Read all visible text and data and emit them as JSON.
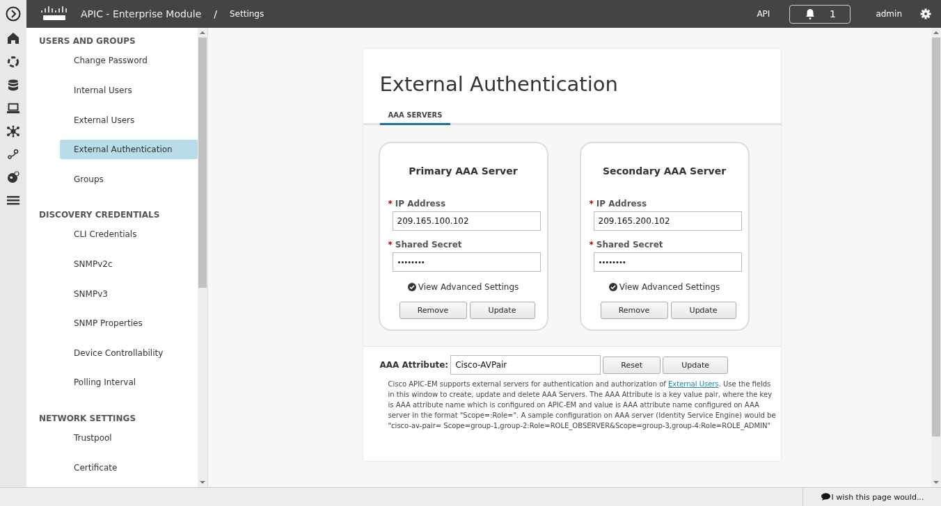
{
  "header": {
    "product": "APIC - Enterprise Module",
    "separator": "/",
    "page": "Settings",
    "api": "API",
    "notifications": "1",
    "user": "admin"
  },
  "rail": [
    {
      "kind": "expand"
    },
    {
      "kind": "home"
    },
    {
      "kind": "ring"
    },
    {
      "kind": "database"
    },
    {
      "kind": "laptop"
    },
    {
      "kind": "network"
    },
    {
      "kind": "path"
    },
    {
      "kind": "globe"
    },
    {
      "kind": "sliders"
    }
  ],
  "sidebar": {
    "sections": [
      {
        "title": "USERS AND GROUPS",
        "items": [
          {
            "label": "Change Password",
            "selected": false
          },
          {
            "label": "Internal Users",
            "selected": false
          },
          {
            "label": "External Users",
            "selected": false
          },
          {
            "label": "External Authentication",
            "selected": true
          },
          {
            "label": "Groups",
            "selected": false
          }
        ]
      },
      {
        "title": "DISCOVERY CREDENTIALS",
        "items": [
          {
            "label": "CLI Credentials",
            "selected": false
          },
          {
            "label": "SNMPv2c",
            "selected": false
          },
          {
            "label": "SNMPv3",
            "selected": false
          },
          {
            "label": "SNMP Properties",
            "selected": false
          },
          {
            "label": "Device Controllability",
            "selected": false
          },
          {
            "label": "Polling Interval",
            "selected": false
          }
        ]
      },
      {
        "title": "NETWORK SETTINGS",
        "items": [
          {
            "label": "Trustpool",
            "selected": false
          },
          {
            "label": "Certificate",
            "selected": false
          }
        ]
      }
    ]
  },
  "page": {
    "title": "External Authentication",
    "tabs": [
      {
        "label": "AAA SERVERS",
        "selected": true
      }
    ],
    "servers": [
      {
        "title": "Primary AAA Server",
        "required_mark": "*",
        "ip_label": "IP Address",
        "ip_value": "209.165.100.102",
        "secret_label": "Shared Secret",
        "secret_value": "••••••••",
        "advanced": "View Advanced Settings",
        "buttons": [
          "Remove",
          "Update"
        ]
      },
      {
        "title": "Secondary AAA Server",
        "required_mark": "*",
        "ip_label": "IP Address",
        "ip_value": "209.165.200.102",
        "secret_label": "Shared Secret",
        "secret_value": "••••••••",
        "advanced": "View Advanced Settings",
        "buttons": [
          "Remove",
          "Update"
        ]
      }
    ],
    "attribute": {
      "label": "AAA Attribute:",
      "value": "Cisco-AVPair",
      "buttons": [
        "Reset",
        "Update"
      ]
    },
    "description": {
      "before": "Cisco APIC-EM supports external servers for authentication and authorization of ",
      "link": "External Users",
      "after": ". Use the fields in this window to create, update and delete AAA Servers. The AAA Attribute is a key value pair, where the key is AAA attribute name which is configured on APIC-EM and value is AAA attribute name configured on AAA server in the format \"Scope=:Role=\". A sample configuration on AAA server (Identity Service Engine) would be \"cisco-av-pair= Scope=group-1,group-2:Role=ROLE_OBSERVER&Scope=group-3,group-4:Role=ROLE_ADMIN\""
    }
  },
  "footer": {
    "feedback": "I wish this page would..."
  }
}
